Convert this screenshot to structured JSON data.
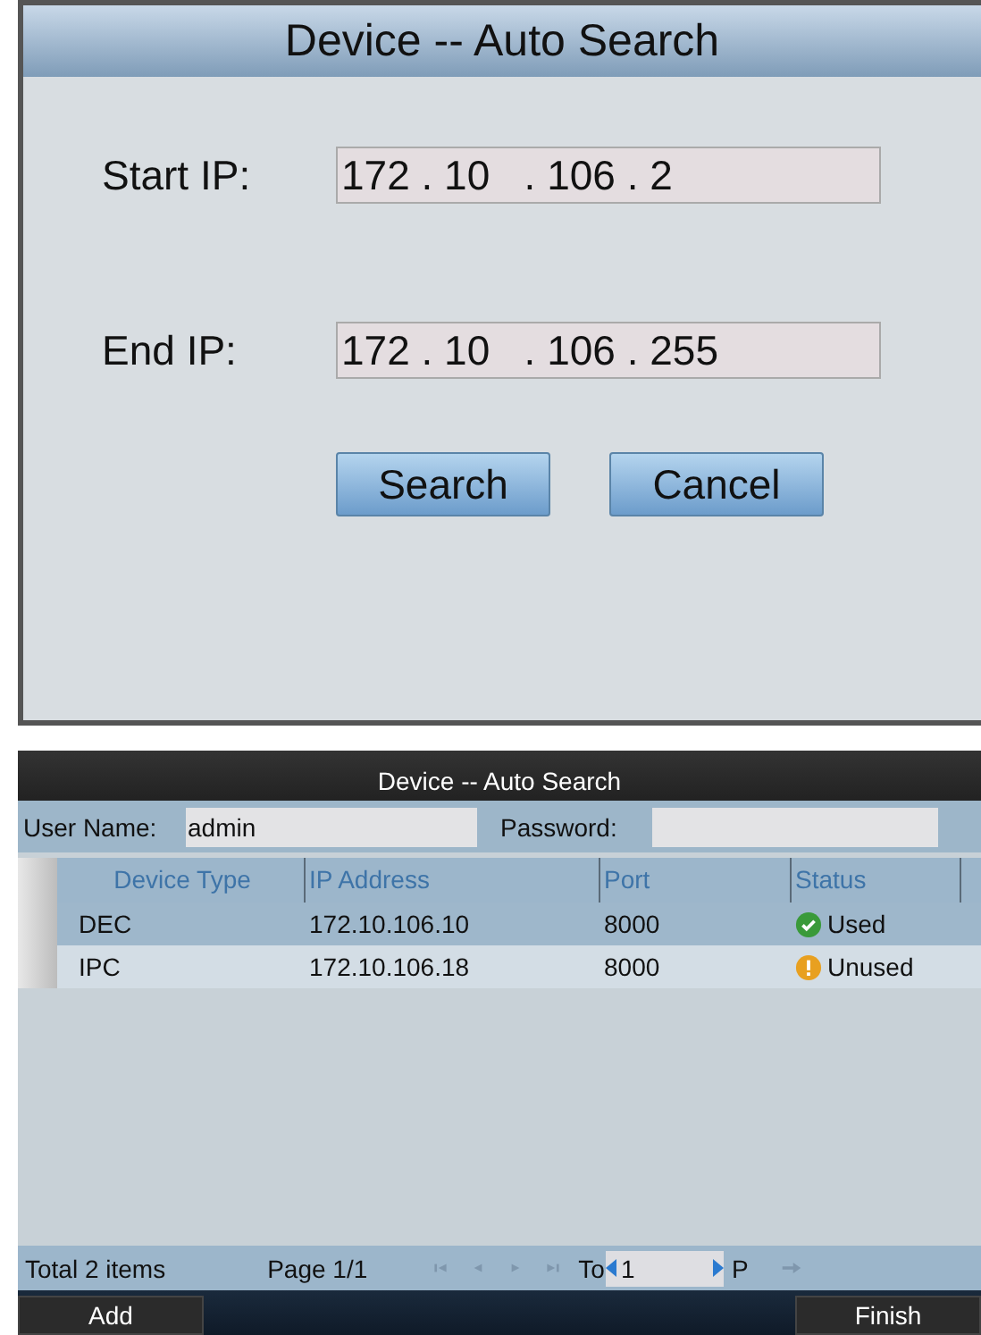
{
  "search_dialog": {
    "title": "Device -- Auto Search",
    "fields": [
      {
        "label": "Start IP:",
        "value": "172 . 10   . 106 . 2"
      },
      {
        "label": "End IP:",
        "value": "172 . 10   . 106 . 255"
      }
    ],
    "buttons": [
      "Search",
      "Cancel"
    ]
  },
  "results_dialog": {
    "title": "Device -- Auto Search",
    "user_name": {
      "label": "User Name:",
      "value": "admin"
    },
    "password": {
      "label": "Password:"
    },
    "table": {
      "columns": [
        "Device Type",
        "IP Address",
        "Port",
        "Status"
      ],
      "rows": [
        {
          "device_type": "DEC",
          "ip": "172.10.106.10",
          "port": "8000",
          "status": "Used",
          "kind": "used",
          "selected": true
        },
        {
          "device_type": "IPC",
          "ip": "172.10.106.18",
          "port": "8000",
          "status": "Unused",
          "kind": "unused",
          "selected": false
        }
      ]
    },
    "footer": {
      "total": "Total 2 items",
      "page": "Page 1/1",
      "to_label": "To",
      "page_input": "1",
      "p_label": "P"
    },
    "buttons": [
      "Add",
      "Finish"
    ]
  }
}
